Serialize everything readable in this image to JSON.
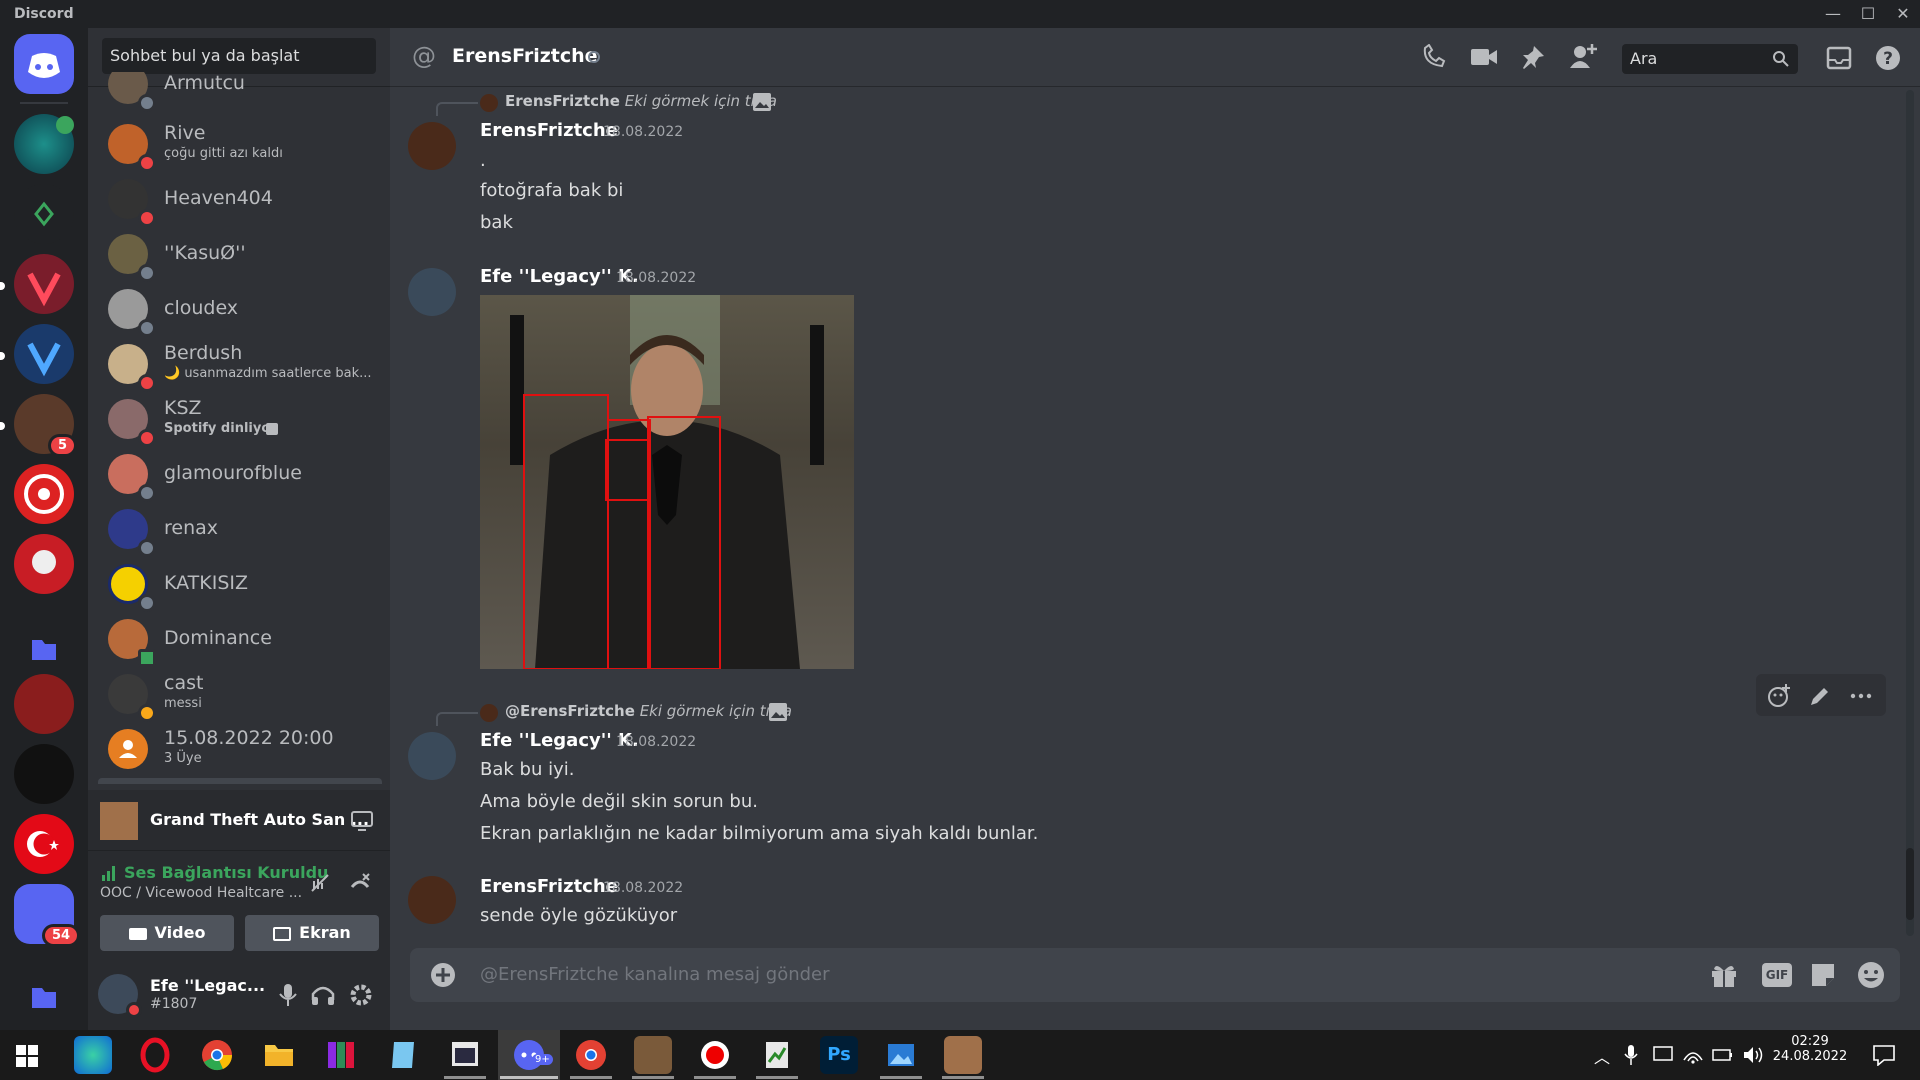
{
  "window": {
    "app_name": "Discord",
    "controls": {
      "minimize": "—",
      "maximize": "☐",
      "close": "✕"
    }
  },
  "servers": {
    "badges": {
      "s6": "5",
      "s12": "54"
    }
  },
  "dm_sidebar": {
    "search_placeholder": "Sohbet bul ya da başlat",
    "items": [
      {
        "name": "Armutcu",
        "sub": "",
        "status": "#747f8d"
      },
      {
        "name": "Rive",
        "sub": "çoğu gitti azı kaldı",
        "status": "#ed4245"
      },
      {
        "name": "Heaven404",
        "sub": "",
        "status": "#ed4245"
      },
      {
        "name": "''KasuØ''",
        "sub": "",
        "status": "#747f8d"
      },
      {
        "name": "cloudex",
        "sub": "",
        "status": "#747f8d"
      },
      {
        "name": "Berdush",
        "sub": "🌙 usanmazdım saatlerce bak...",
        "status": "#ed4245"
      },
      {
        "name": "KSZ",
        "sub": "Spotify dinliyor",
        "status": "#ed4245"
      },
      {
        "name": "glamourofblue",
        "sub": "",
        "status": "#747f8d"
      },
      {
        "name": "renax",
        "sub": "",
        "status": "#747f8d"
      },
      {
        "name": "KATKISIZ",
        "sub": "",
        "status": "#747f8d"
      },
      {
        "name": "Dominance",
        "sub": "",
        "status": "#3ba55d"
      },
      {
        "name": "cast",
        "sub": "messi",
        "status": "#faa81a"
      },
      {
        "name": "15.08.2022 20:00",
        "sub": "3 Üye",
        "status": ""
      }
    ]
  },
  "activity": {
    "title": "Grand Theft Auto San ..."
  },
  "voice": {
    "status": "Ses Bağlantısı Kuruldu",
    "channel": "OOC / Vicewood Healtcare ...",
    "video_label": "Video",
    "screen_label": "Ekran"
  },
  "user_panel": {
    "name": "Efe ''Legac...",
    "tag": "#1807"
  },
  "header": {
    "title": "ErensFriztche",
    "search_placeholder": "Ara"
  },
  "messages": [
    {
      "reply_user": "ErensFriztche",
      "reply_text": "Eki görmek için tıkla",
      "author": "ErensFriztche",
      "timestamp": "18.08.2022",
      "lines": [
        ".",
        "fotoğrafa bak bi",
        "bak"
      ]
    },
    {
      "author": "Efe ''Legacy'' K.",
      "timestamp": "18.08.2022",
      "lines": [],
      "image": true
    },
    {
      "reply_user": "@ErensFriztche",
      "reply_text": "Eki görmek için tıkla",
      "author": "Efe ''Legacy'' K.",
      "timestamp": "18.08.2022",
      "lines": [
        "Bak bu iyi.",
        "Ama böyle değil skin sorun bu.",
        "Ekran parlaklığın ne kadar bilmiyorum ama siyah kaldı bunlar."
      ]
    },
    {
      "author": "ErensFriztche",
      "timestamp": "18.08.2022",
      "lines": [
        "sende öyle gözüküyor"
      ]
    }
  ],
  "composer": {
    "placeholder": "@ErensFriztche kanalına mesaj gönder",
    "gif_label": "GIF"
  },
  "taskbar": {
    "time": "02:29",
    "date": "24.08.2022",
    "ps_label": "Ps",
    "discord_badge": "9+"
  }
}
